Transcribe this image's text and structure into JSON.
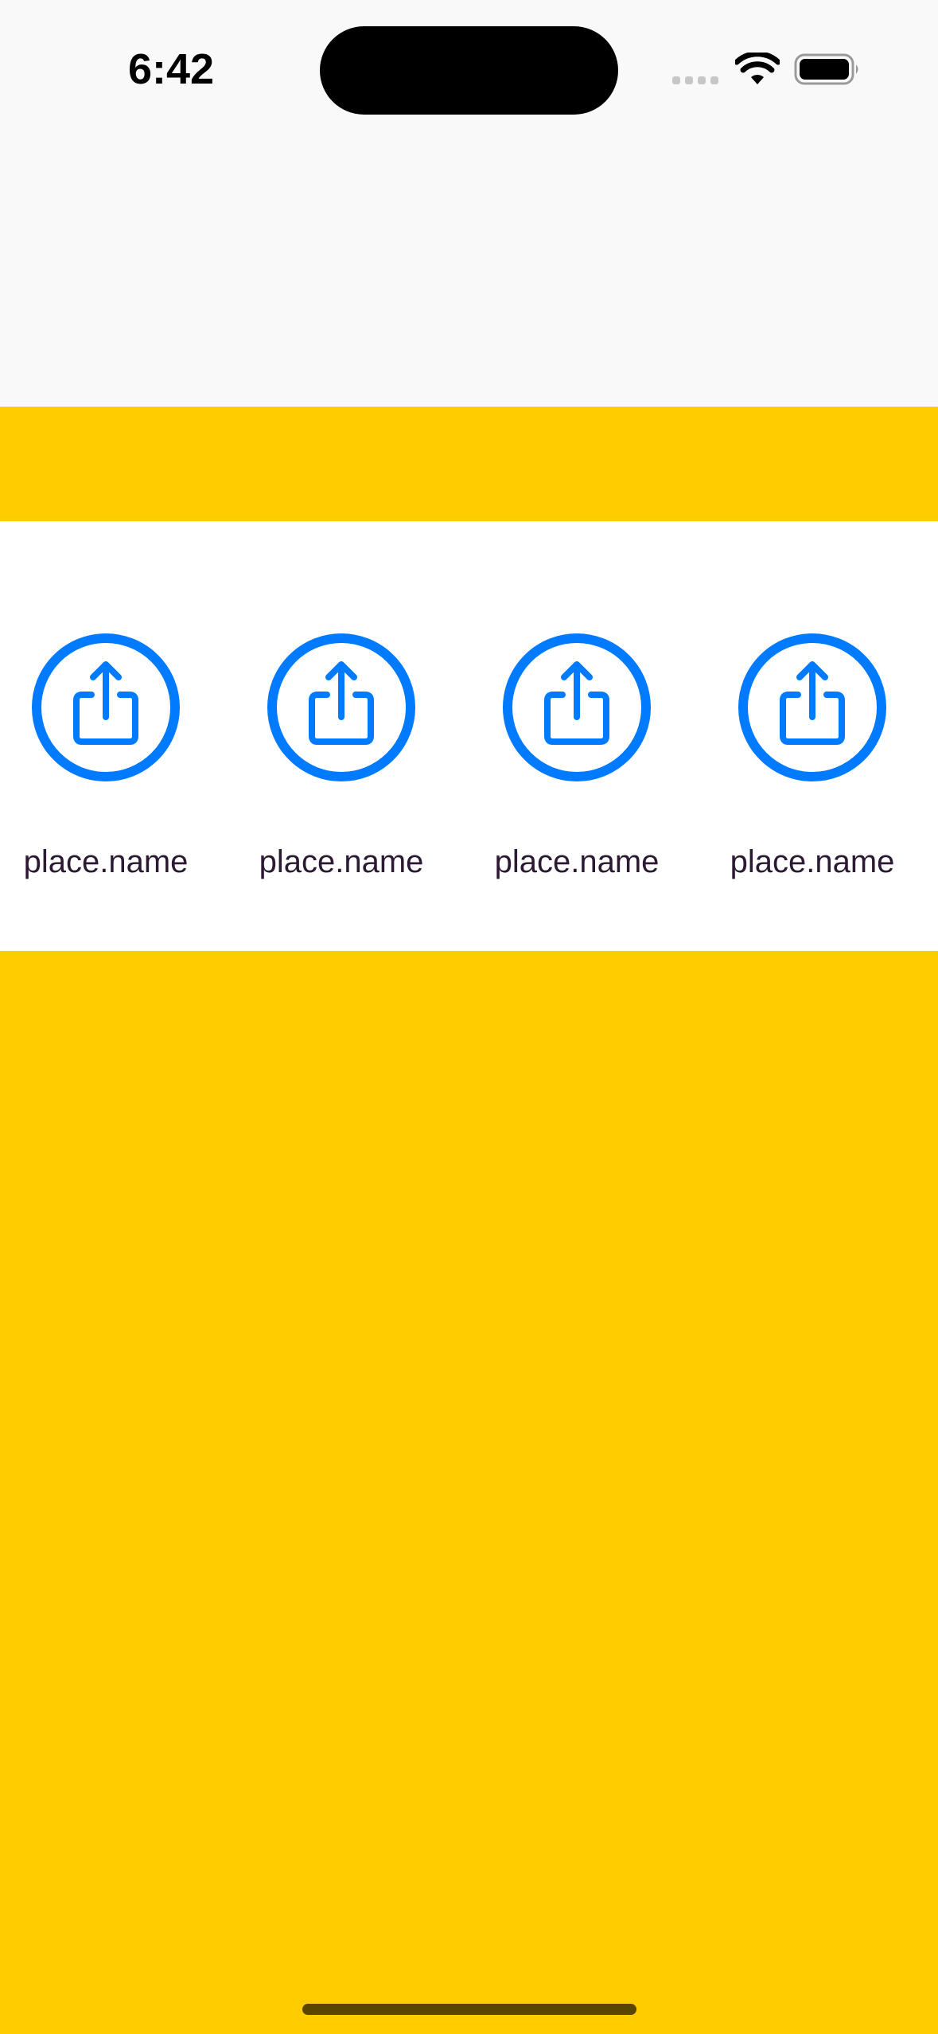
{
  "status_bar": {
    "time": "6:42",
    "icons": [
      "cellular-signal-icon",
      "wifi-icon",
      "battery-icon"
    ]
  },
  "colors": {
    "background_yellow": "#FFCC00",
    "status_area": "#F9F9F9",
    "icon_blue": "#007AFF",
    "label_text": "#2C1A33"
  },
  "places": {
    "items": [
      {
        "label": "place.name",
        "icon": "share-icon"
      },
      {
        "label": "place.name",
        "icon": "share-icon"
      },
      {
        "label": "place.name",
        "icon": "share-icon"
      },
      {
        "label": "place.name",
        "icon": "share-icon"
      }
    ]
  }
}
